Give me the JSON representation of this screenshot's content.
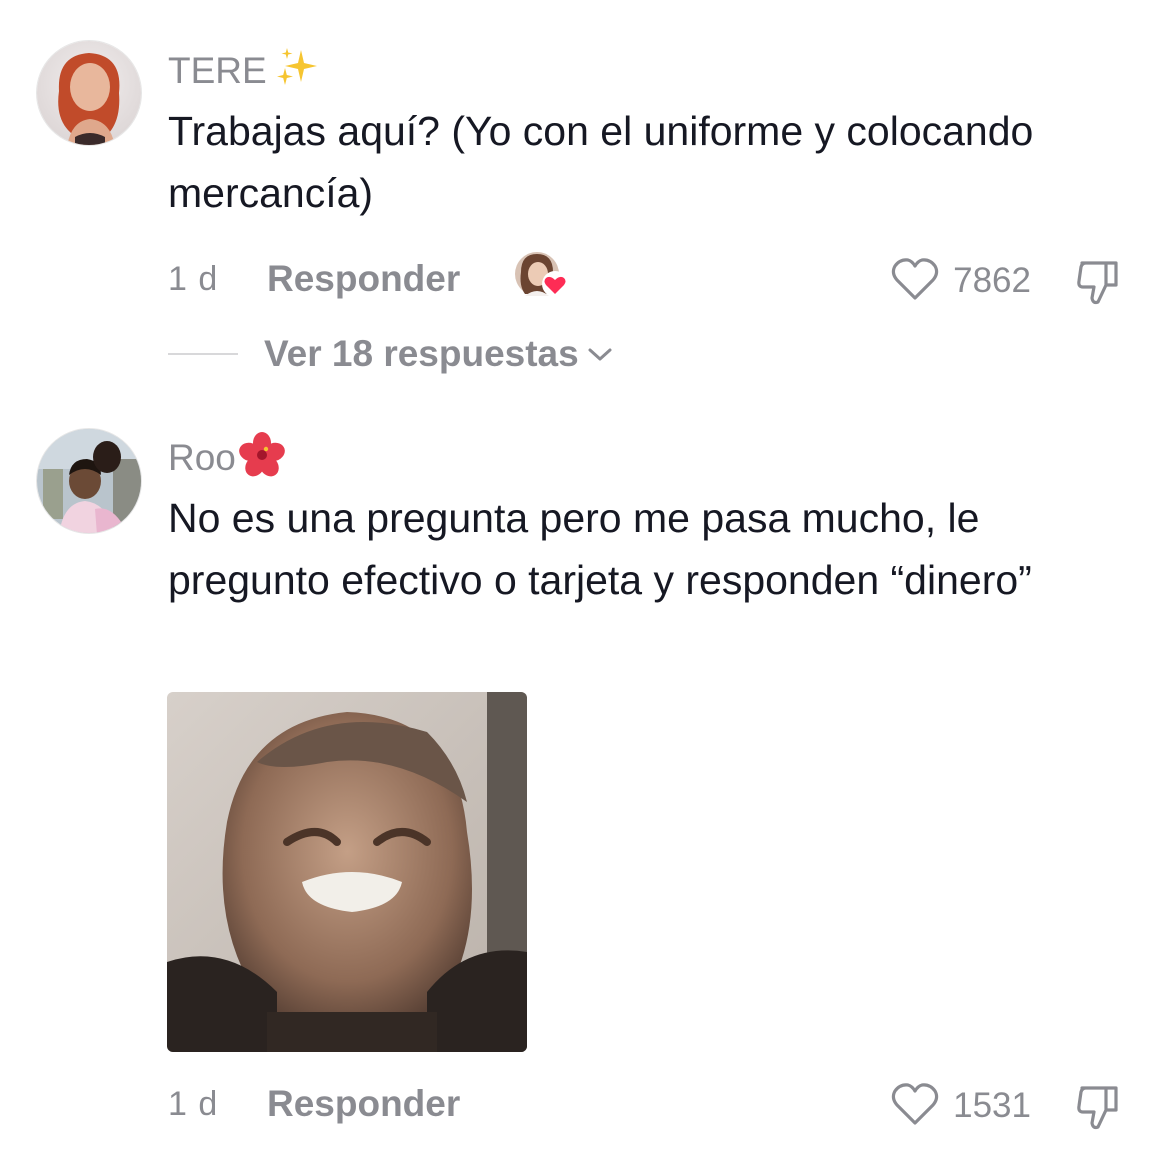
{
  "comments": [
    {
      "username": "TERE",
      "username_emoji": "sparkles-emoji",
      "text": "Trabajas aquí? (Yo con el uniforme y colocando mercancía)",
      "time": "1 d",
      "reply_label": "Responder",
      "likes": "7862",
      "liked_by_creator": true,
      "view_replies_label": "Ver 18 respuestas"
    },
    {
      "username": "Roo",
      "username_emoji": "hibiscus-emoji",
      "text": "No es una pregunta pero me pasa mucho, le pregunto efectivo o tarjeta y responden “dinero”",
      "time": "1 d",
      "reply_label": "Responder",
      "likes": "1531",
      "has_gif": true
    }
  ],
  "colors": {
    "primary_text": "#161823",
    "secondary_text": "#8a8b91",
    "heart_red": "#fe2c55"
  }
}
